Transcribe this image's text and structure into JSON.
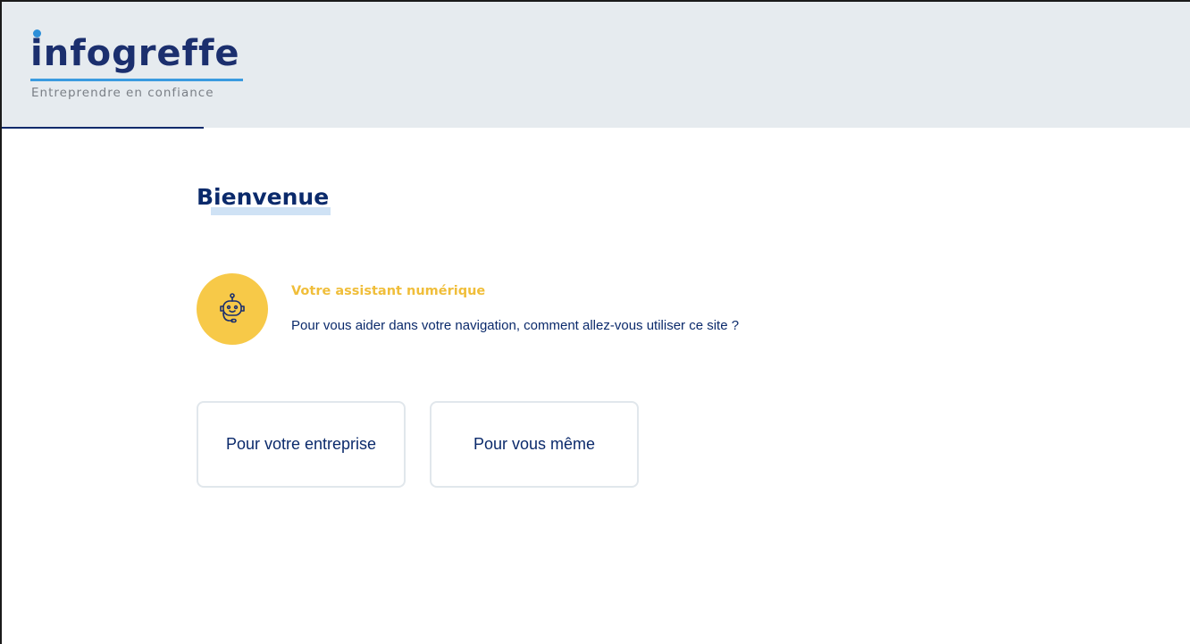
{
  "brand": {
    "logo_text": "infogreffe",
    "tagline": "Entreprendre en confiance",
    "logo_color": "#1b2f6e",
    "accent_color": "#2d8fd8"
  },
  "page": {
    "title": "Bienvenue"
  },
  "assistant": {
    "icon": "robot-icon",
    "title": "Votre assistant numérique",
    "message": "Pour vous aider dans votre navigation, comment allez-vous utiliser ce site ?",
    "color": "#f7c948"
  },
  "choices": [
    {
      "label": "Pour votre entreprise"
    },
    {
      "label": "Pour vous même"
    }
  ]
}
